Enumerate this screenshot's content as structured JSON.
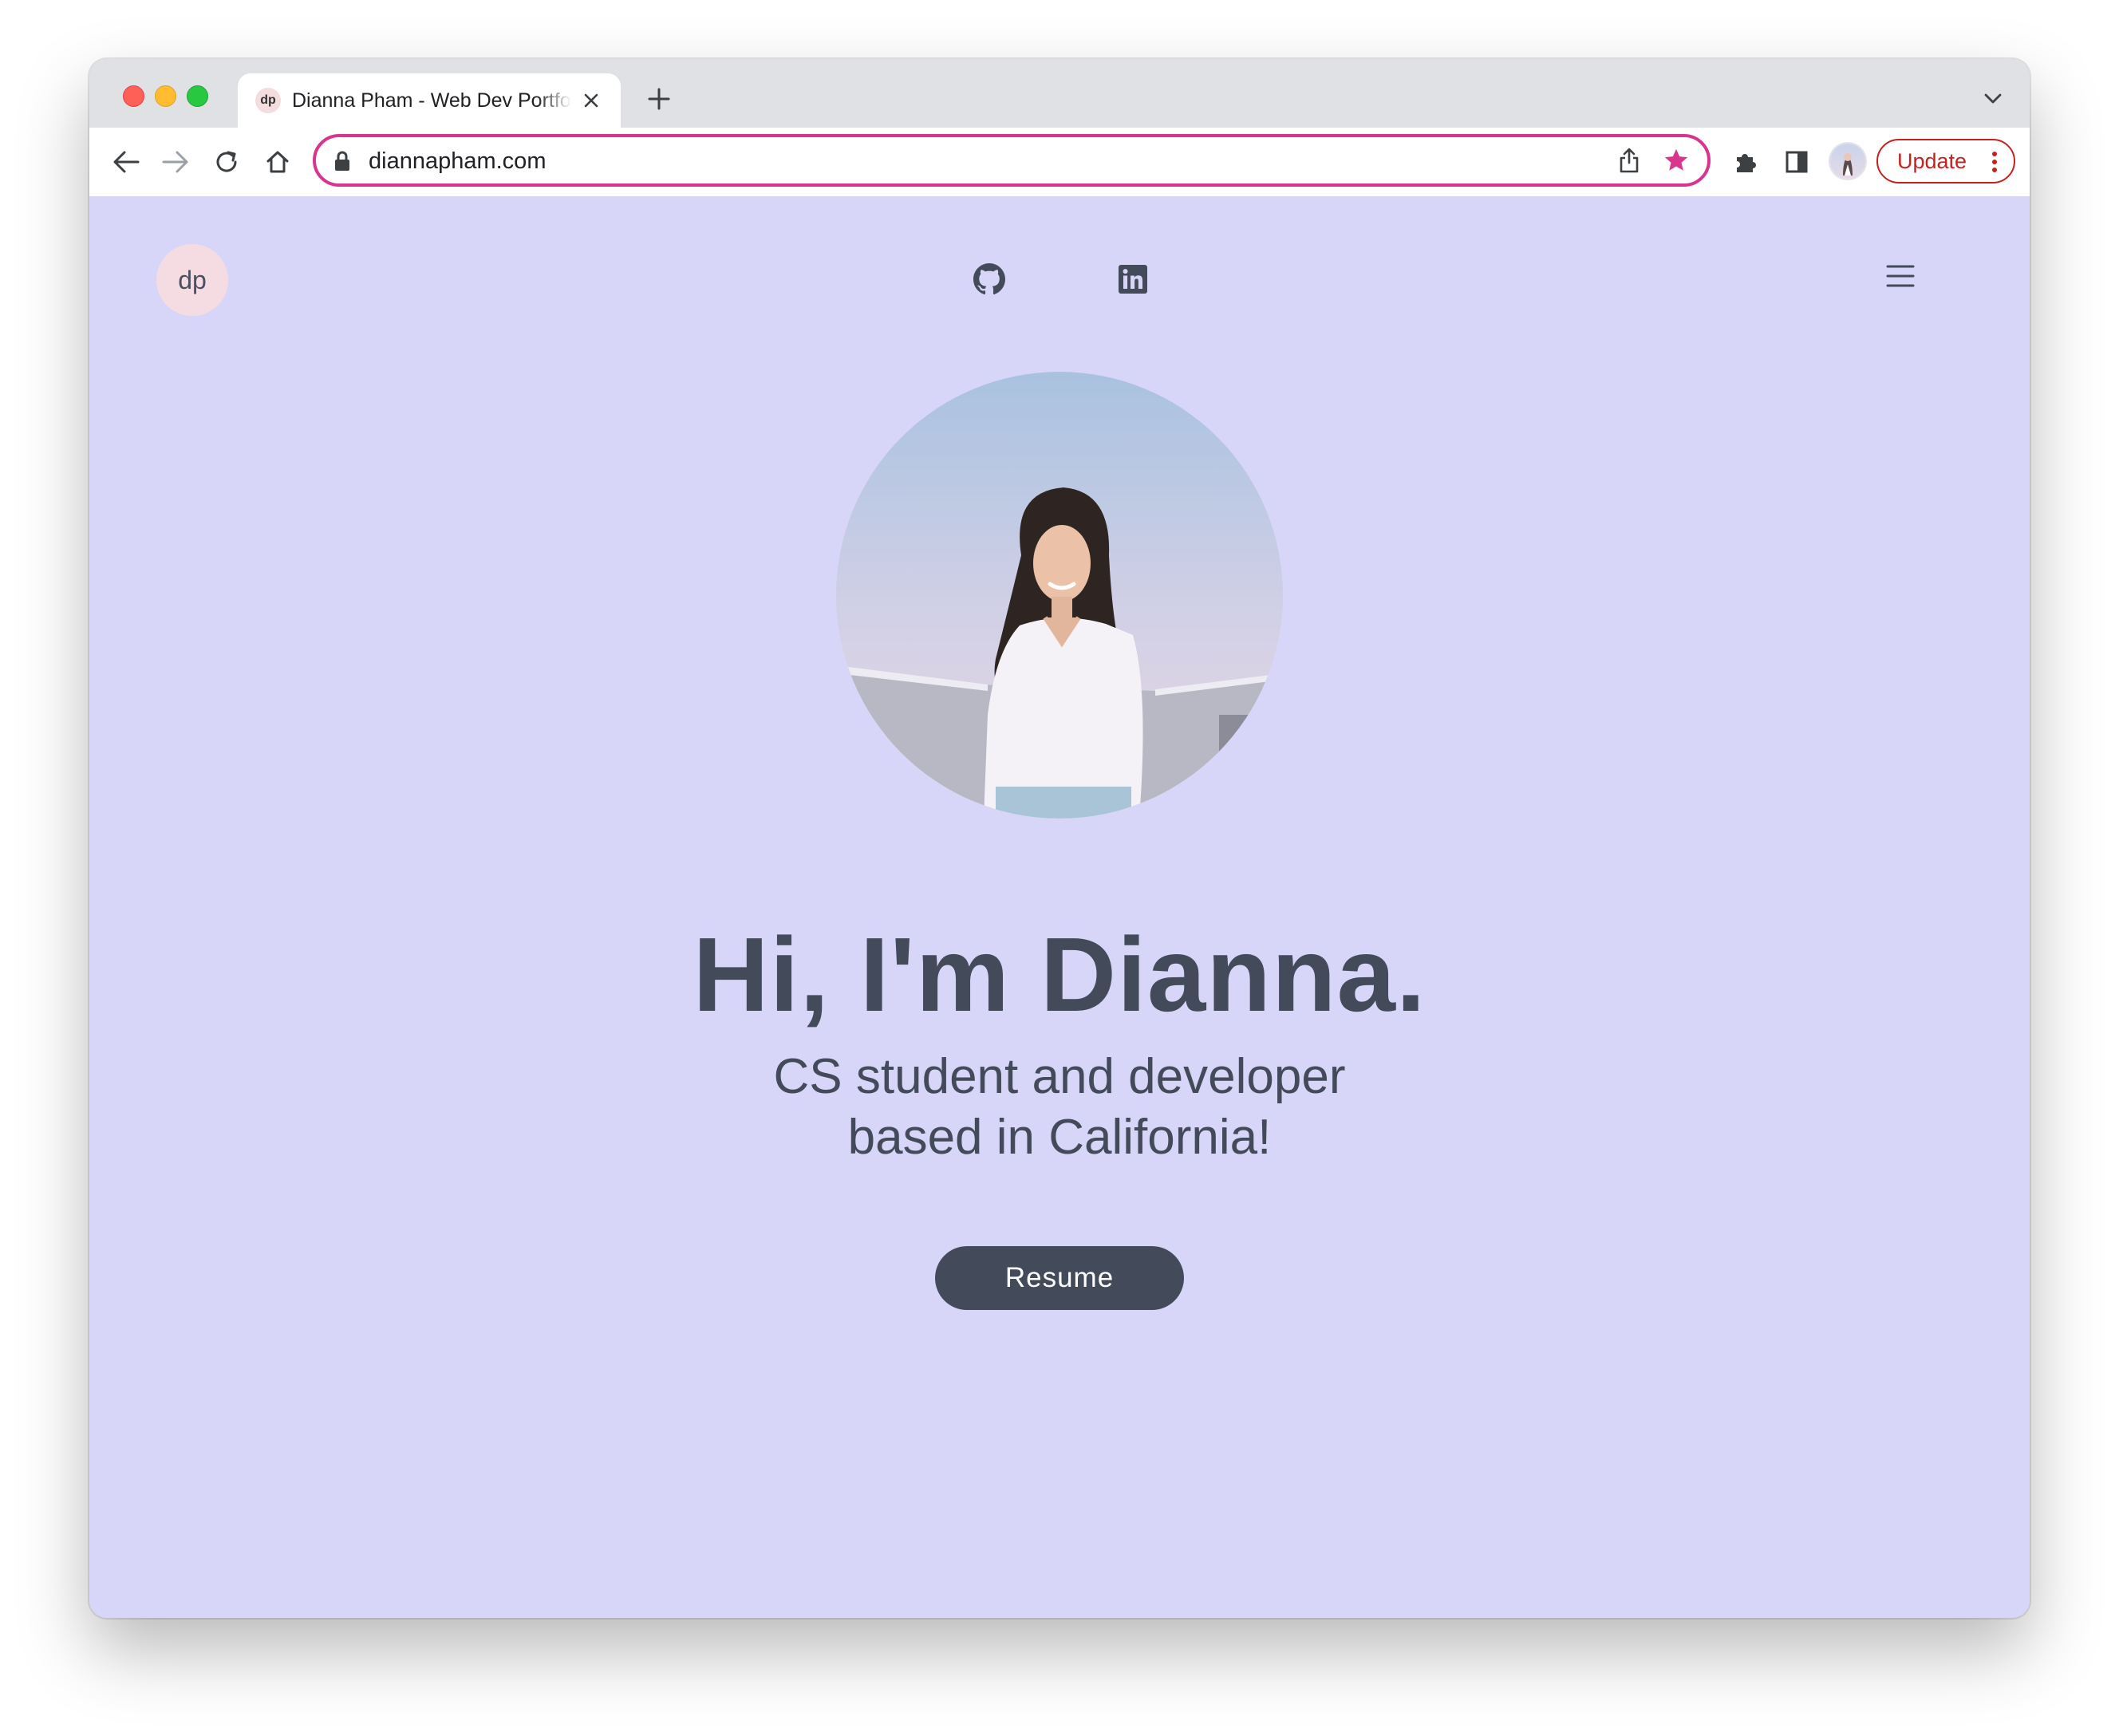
{
  "browser": {
    "tab": {
      "favicon_text": "dp",
      "title": "Dianna Pham - Web Dev Portfolio"
    },
    "address_bar": {
      "url": "diannapham.com"
    },
    "update_button_label": "Update",
    "accent_color": "#d9358f",
    "update_color": "#c5221f"
  },
  "site": {
    "logo_text": "dp",
    "social_links": [
      {
        "icon": "github-icon"
      },
      {
        "icon": "linkedin-icon"
      }
    ],
    "menu_icon": "hamburger-menu-icon",
    "hero": {
      "title": "Hi, I'm Dianna.",
      "subtitle_line1": "CS student and developer",
      "subtitle_line2": "based in California!",
      "resume_label": "Resume"
    },
    "background_color": "#d8d6f8",
    "text_color": "#434b5b"
  }
}
